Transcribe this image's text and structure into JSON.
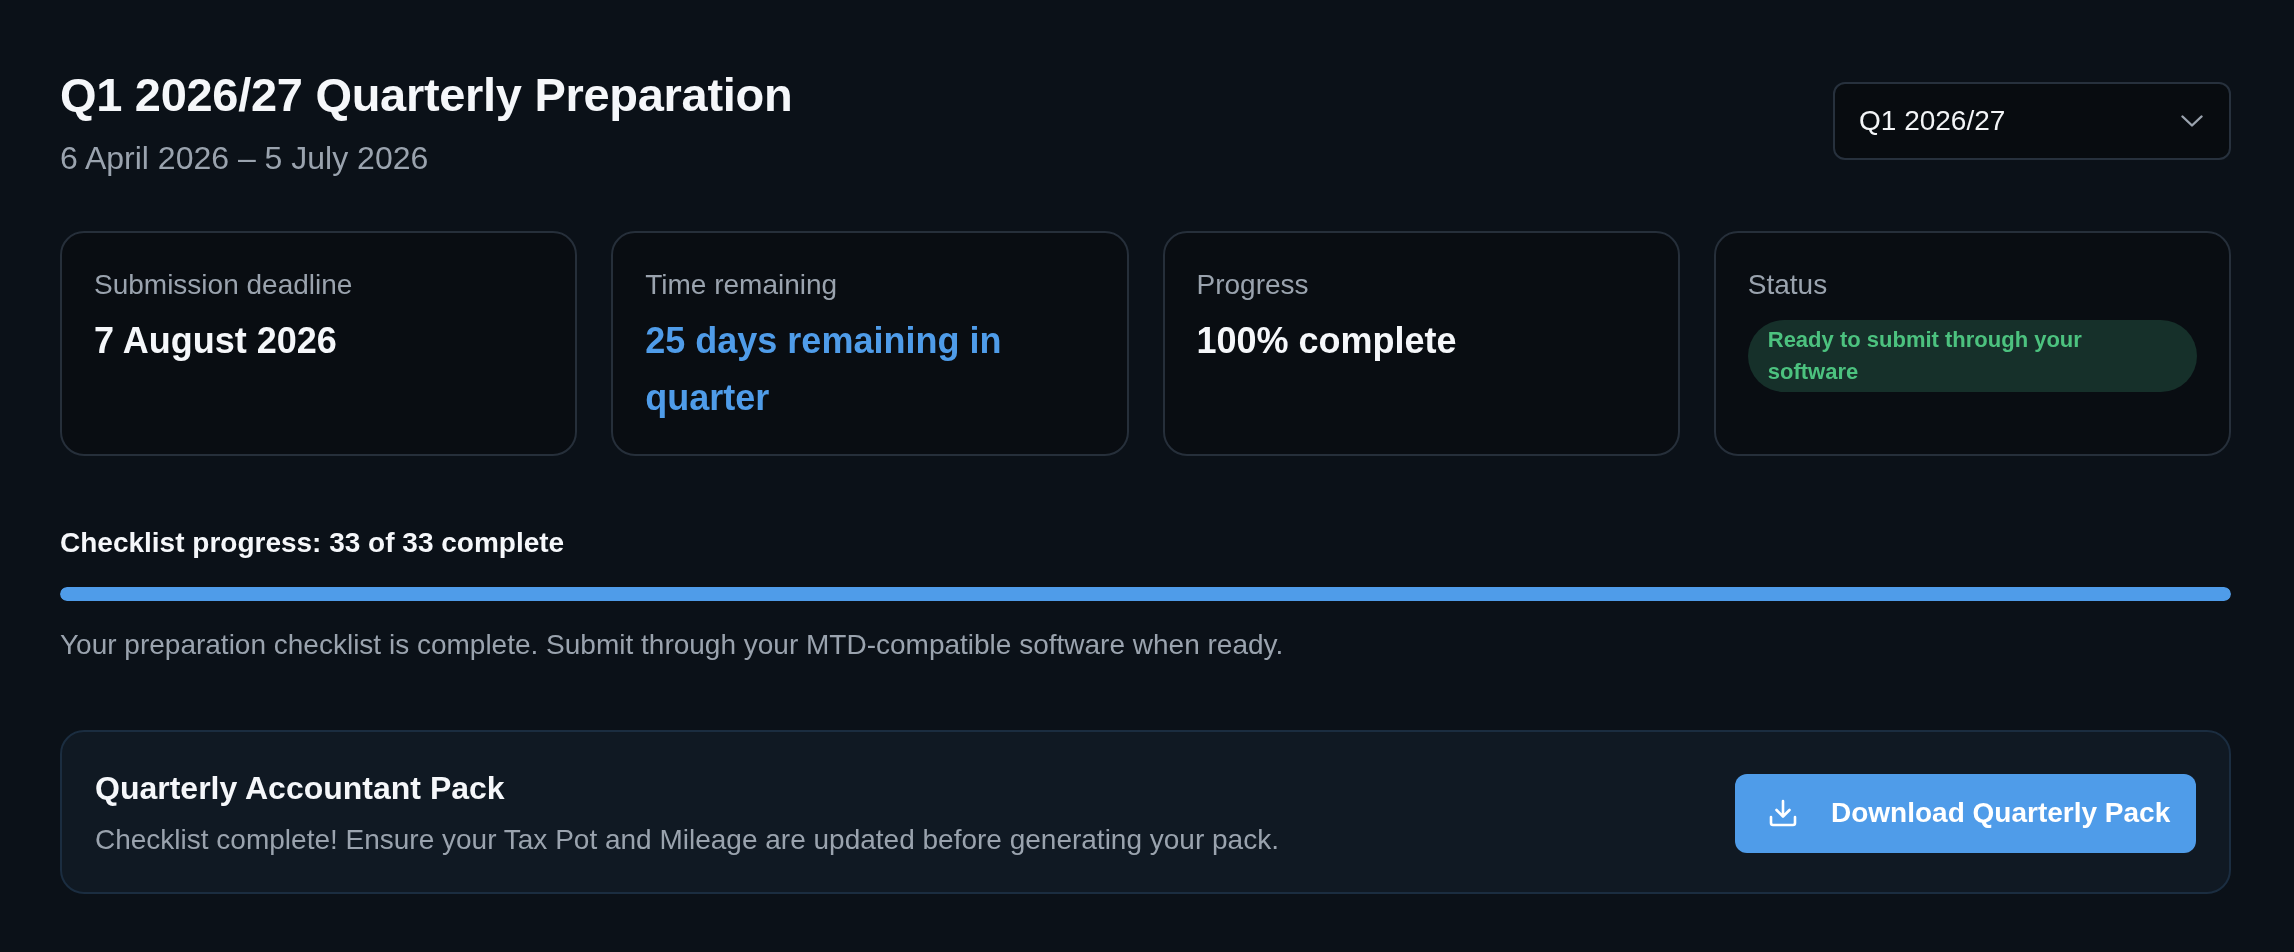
{
  "header": {
    "title": "Q1 2026/27 Quarterly Preparation",
    "date_range": "6 April 2026 – 5 July 2026",
    "quarter_select": {
      "value": "Q1 2026/27"
    }
  },
  "summary_cards": [
    {
      "kind": "text",
      "label": "Submission deadline",
      "value": "7 August 2026"
    },
    {
      "kind": "highlight",
      "label": "Time remaining",
      "value": "25 days remaining in quarter"
    },
    {
      "kind": "text",
      "label": "Progress",
      "value": "100% complete"
    },
    {
      "kind": "badge",
      "label": "Status",
      "value": "Ready to submit through your software"
    }
  ],
  "checklist": {
    "label": "Checklist progress: 33 of 33 complete",
    "level": 1,
    "note": "Your preparation checklist is complete. Submit through your MTD-compatible software when ready."
  },
  "accountant_pack": {
    "title": "Quarterly Accountant Pack",
    "description": "Checklist complete! Ensure your Tax Pot and Mileage are updated before generating your pack.",
    "button": "Download Quarterly Pack"
  }
}
